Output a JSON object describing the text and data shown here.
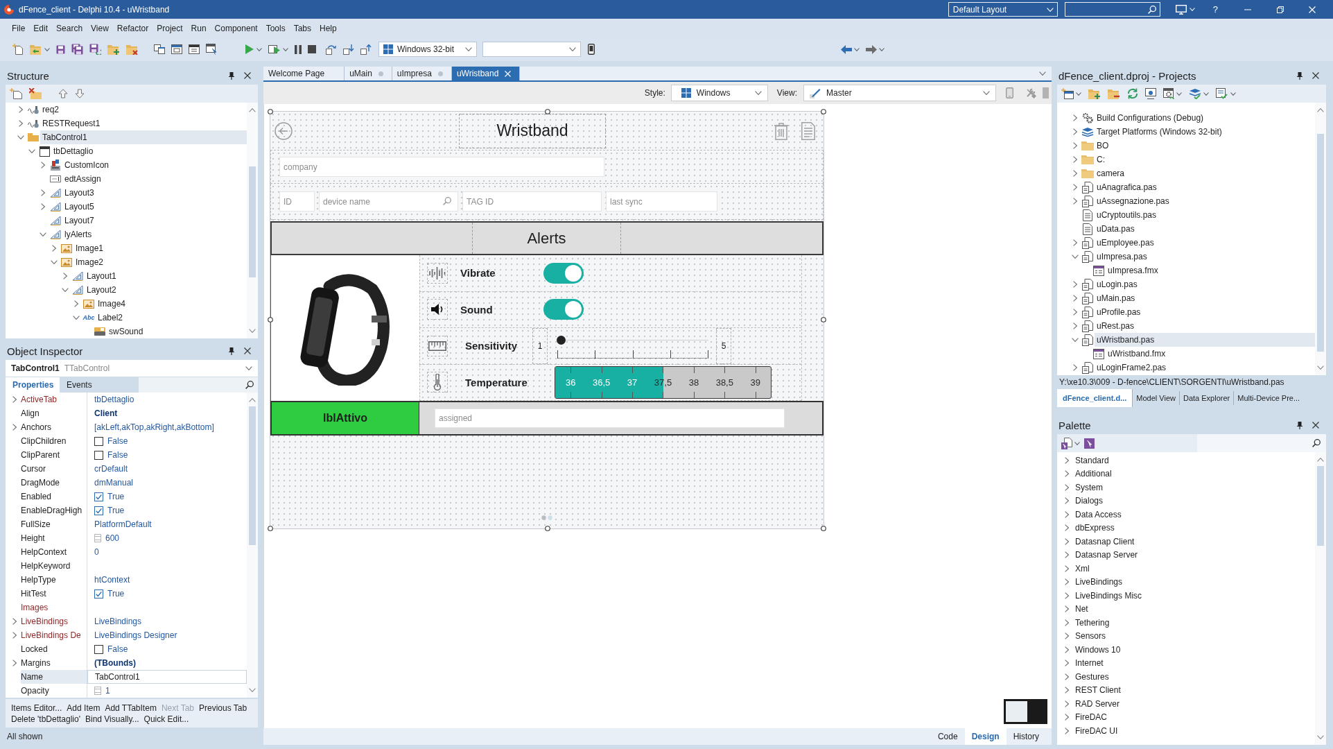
{
  "window": {
    "title": "dFence_client - Delphi 10.4 - uWristband",
    "layout": "Default Layout",
    "help": "?"
  },
  "menu": [
    "File",
    "Edit",
    "Search",
    "View",
    "Refactor",
    "Project",
    "Run",
    "Component",
    "Tools",
    "Tabs",
    "Help"
  ],
  "toolbar": {
    "platform": "Windows 32-bit"
  },
  "structure": {
    "title": "Structure",
    "tree": [
      {
        "label": "req2",
        "kind": "rest",
        "expanded": false,
        "selected": false
      },
      {
        "label": "RESTRequest1",
        "kind": "rest",
        "expanded": false,
        "selected": false
      },
      {
        "label": "TabControl1",
        "kind": "tabcontrol",
        "expanded": true,
        "selected": true,
        "children": [
          {
            "label": "tbDettaglio",
            "kind": "tabitem",
            "expanded": true,
            "selected": false,
            "children": [
              {
                "label": "CustomIcon",
                "kind": "component",
                "expanded": false,
                "selected": false
              },
              {
                "label": "edtAssign",
                "kind": "edit",
                "selected": false
              },
              {
                "label": "Layout3",
                "kind": "layout",
                "expanded": false,
                "selected": false
              },
              {
                "label": "Layout5",
                "kind": "layout",
                "expanded": false,
                "selected": false
              },
              {
                "label": "Layout7",
                "kind": "layout",
                "selected": false
              },
              {
                "label": "lyAlerts",
                "kind": "layout",
                "expanded": true,
                "selected": false,
                "children": [
                  {
                    "label": "Image1",
                    "kind": "image",
                    "expanded": false,
                    "selected": false
                  },
                  {
                    "label": "Image2",
                    "kind": "image",
                    "expanded": true,
                    "selected": false,
                    "children": [
                      {
                        "label": "Layout1",
                        "kind": "layout",
                        "expanded": false,
                        "selected": false
                      },
                      {
                        "label": "Layout2",
                        "kind": "layout",
                        "expanded": true,
                        "selected": false,
                        "children": [
                          {
                            "label": "Image4",
                            "kind": "image",
                            "expanded": false,
                            "selected": false
                          },
                          {
                            "label": "Label2",
                            "kind": "label",
                            "icon_text": "Abc",
                            "expanded": true,
                            "selected": false,
                            "children": [
                              {
                                "label": "swSound",
                                "kind": "switch",
                                "selected": false
                              }
                            ]
                          }
                        ]
                      }
                    ]
                  }
                ]
              }
            ]
          }
        ]
      }
    ]
  },
  "object_inspector": {
    "title": "Object Inspector",
    "component": "TabControl1",
    "component_type": "TTabControl",
    "tabs": [
      {
        "label": "Properties",
        "selected": true
      },
      {
        "label": "Events",
        "selected": false
      }
    ],
    "properties": [
      {
        "name": "ActiveTab",
        "value": "tbDettaglio",
        "kind": "text",
        "expandable": true,
        "reference": true,
        "modified": false,
        "selected": false
      },
      {
        "name": "Align",
        "value": "Client",
        "kind": "text",
        "expandable": false,
        "reference": false,
        "modified": true,
        "selected": false
      },
      {
        "name": "Anchors",
        "value": "[akLeft,akTop,akRight,akBottom]",
        "kind": "text",
        "expandable": true,
        "reference": false,
        "modified": false,
        "selected": false
      },
      {
        "name": "ClipChildren",
        "value": "False",
        "kind": "checkbox",
        "checked": false,
        "expandable": false,
        "reference": false,
        "modified": false,
        "selected": false
      },
      {
        "name": "ClipParent",
        "value": "False",
        "kind": "checkbox",
        "checked": false,
        "expandable": false,
        "reference": false,
        "modified": false,
        "selected": false
      },
      {
        "name": "Cursor",
        "value": "crDefault",
        "kind": "text",
        "expandable": false,
        "reference": false,
        "modified": false,
        "selected": false
      },
      {
        "name": "DragMode",
        "value": "dmManual",
        "kind": "text",
        "expandable": false,
        "reference": false,
        "modified": false,
        "selected": false
      },
      {
        "name": "Enabled",
        "value": "True",
        "kind": "checkbox",
        "checked": true,
        "expandable": false,
        "reference": false,
        "modified": false,
        "selected": false
      },
      {
        "name": "EnableDragHigh",
        "value": "True",
        "kind": "checkbox",
        "checked": true,
        "expandable": false,
        "reference": false,
        "modified": false,
        "selected": false
      },
      {
        "name": "FullSize",
        "value": "PlatformDefault",
        "kind": "text",
        "expandable": false,
        "reference": false,
        "modified": false,
        "selected": false
      },
      {
        "name": "Height",
        "value": "600",
        "kind": "spin",
        "expandable": false,
        "reference": false,
        "modified": false,
        "selected": false
      },
      {
        "name": "HelpContext",
        "value": "0",
        "kind": "text",
        "expandable": false,
        "reference": false,
        "modified": false,
        "selected": false
      },
      {
        "name": "HelpKeyword",
        "kind": "text",
        "expandable": false,
        "reference": false,
        "selected": false
      },
      {
        "name": "HelpType",
        "value": "htContext",
        "kind": "text",
        "expandable": false,
        "reference": false,
        "modified": false,
        "selected": false
      },
      {
        "name": "HitTest",
        "value": "True",
        "kind": "checkbox",
        "checked": true,
        "expandable": false,
        "reference": false,
        "modified": false,
        "selected": false
      },
      {
        "name": "Images",
        "kind": "text",
        "expandable": false,
        "reference": true,
        "selected": false
      },
      {
        "name": "LiveBindings",
        "value": "LiveBindings",
        "kind": "text",
        "expandable": true,
        "reference": true,
        "modified": false,
        "selected": false
      },
      {
        "name": "LiveBindings De",
        "value": "LiveBindings Designer",
        "kind": "text",
        "expandable": true,
        "reference": true,
        "modified": false,
        "selected": false
      },
      {
        "name": "Locked",
        "value": "False",
        "kind": "checkbox",
        "checked": false,
        "expandable": false,
        "reference": false,
        "modified": false,
        "selected": false
      },
      {
        "name": "Margins",
        "value": "(TBounds)",
        "kind": "text",
        "expandable": true,
        "reference": false,
        "modified": true,
        "selected": false
      },
      {
        "name": "Name",
        "value": "TabControl1",
        "kind": "edit",
        "expandable": false,
        "reference": false,
        "modified": false,
        "selected": true
      },
      {
        "name": "Opacity",
        "value": "1",
        "kind": "spin",
        "expandable": false,
        "reference": false,
        "modified": false,
        "selected": false
      }
    ],
    "actions": [
      {
        "label": "Items Editor...",
        "disabled": false
      },
      {
        "label": "Add Item",
        "disabled": false
      },
      {
        "label": "Add TTabItem",
        "disabled": false
      },
      {
        "label": "Next Tab",
        "disabled": true
      },
      {
        "label": "Previous Tab",
        "disabled": false
      },
      {
        "label": "Delete 'tbDettaglio'",
        "disabled": false
      },
      {
        "label": "Bind Visually...",
        "disabled": false
      },
      {
        "label": "Quick Edit...",
        "disabled": false
      }
    ],
    "status": "All shown"
  },
  "editor": {
    "tabs": [
      {
        "label": "Welcome Page",
        "selected": false,
        "dot": false
      },
      {
        "label": "uMain",
        "selected": false,
        "dot": true
      },
      {
        "label": "uImpresa",
        "selected": false,
        "dot": true
      },
      {
        "label": "uWristband",
        "selected": true,
        "dot": false
      }
    ],
    "style_label": "Style:",
    "style": "Windows",
    "view_label": "View:",
    "view": "Master",
    "form": {
      "title": "Wristband",
      "company_placeholder": "company",
      "fields": [
        {
          "placeholder": "ID",
          "kind": "plain"
        },
        {
          "placeholder": "device name",
          "kind": "search"
        },
        {
          "placeholder": "TAG ID",
          "kind": "plain"
        },
        {
          "placeholder": "last sync",
          "kind": "plain"
        }
      ],
      "alerts_title": "Alerts",
      "alerts": [
        {
          "kind": "switch",
          "label": "Vibrate",
          "on": true
        },
        {
          "kind": "switch",
          "label": "Sound",
          "on": true
        },
        {
          "kind": "slider",
          "label": "Sensitivity",
          "min": "1",
          "max": "5",
          "level": 0
        },
        {
          "kind": "range",
          "label": "Temperature",
          "level": 0.5,
          "scale": [
            "36",
            "36,5",
            "37",
            "37,5",
            "38",
            "38,5",
            "39"
          ]
        }
      ],
      "status_label": "lblAttivo",
      "assigned_placeholder": "assigned"
    },
    "bottom_tabs": [
      {
        "label": "Code",
        "selected": false
      },
      {
        "label": "Design",
        "selected": true
      },
      {
        "label": "History",
        "selected": false
      }
    ]
  },
  "projects": {
    "title": "dFence_client.dproj - Projects",
    "tree": [
      {
        "label": "Build Configurations (Debug)",
        "kind": "config",
        "expanded": false,
        "selected": false
      },
      {
        "label": "Target Platforms (Windows 32-bit)",
        "kind": "platforms",
        "expanded": false,
        "selected": false
      },
      {
        "label": "BO",
        "kind": "folder",
        "expanded": false,
        "selected": false
      },
      {
        "label": "C:",
        "kind": "folder",
        "expanded": false,
        "selected": false
      },
      {
        "label": "camera",
        "kind": "folder",
        "expanded": false,
        "selected": false
      },
      {
        "label": "uAnagrafica.pas",
        "kind": "unit",
        "expanded": false,
        "selected": false
      },
      {
        "label": "uAssegnazione.pas",
        "kind": "unit",
        "expanded": false,
        "selected": false
      },
      {
        "label": "uCryptoutils.pas",
        "kind": "file",
        "selected": false
      },
      {
        "label": "uData.pas",
        "kind": "file",
        "selected": false
      },
      {
        "label": "uEmployee.pas",
        "kind": "unit",
        "expanded": false,
        "selected": false
      },
      {
        "label": "uImpresa.pas",
        "kind": "unit",
        "expanded": true,
        "selected": false,
        "children": [
          {
            "label": "uImpresa.fmx",
            "kind": "form",
            "selected": false
          }
        ]
      },
      {
        "label": "uLogin.pas",
        "kind": "unit",
        "expanded": false,
        "selected": false
      },
      {
        "label": "uMain.pas",
        "kind": "unit",
        "expanded": false,
        "selected": false
      },
      {
        "label": "uProfile.pas",
        "kind": "unit",
        "expanded": false,
        "selected": false
      },
      {
        "label": "uRest.pas",
        "kind": "unit",
        "expanded": false,
        "selected": false
      },
      {
        "label": "uWristband.pas",
        "kind": "unit",
        "expanded": true,
        "selected": true,
        "children": [
          {
            "label": "uWristband.fmx",
            "kind": "form",
            "selected": false
          }
        ]
      },
      {
        "label": "uLoginFrame2.pas",
        "kind": "unit",
        "expanded": false,
        "selected": false
      }
    ],
    "path": "Y:\\xe10.3\\009 - D-fence\\CLIENT\\SORGENTI\\uWristband.pas",
    "tabs": [
      {
        "label": "dFence_client.d...",
        "selected": true
      },
      {
        "label": "Model View",
        "selected": false
      },
      {
        "label": "Data Explorer",
        "selected": false
      },
      {
        "label": "Multi-Device Pre...",
        "selected": false
      }
    ]
  },
  "palette": {
    "title": "Palette",
    "categories": [
      {
        "label": "Standard",
        "expanded": false
      },
      {
        "label": "Additional",
        "expanded": false
      },
      {
        "label": "System",
        "expanded": false
      },
      {
        "label": "Dialogs",
        "expanded": false
      },
      {
        "label": "Data Access",
        "expanded": false
      },
      {
        "label": "dbExpress",
        "expanded": false
      },
      {
        "label": "Datasnap Client",
        "expanded": false
      },
      {
        "label": "Datasnap Server",
        "expanded": false
      },
      {
        "label": "Xml",
        "expanded": false
      },
      {
        "label": "LiveBindings",
        "expanded": false
      },
      {
        "label": "LiveBindings Misc",
        "expanded": false
      },
      {
        "label": "Net",
        "expanded": false
      },
      {
        "label": "Tethering",
        "expanded": false
      },
      {
        "label": "Sensors",
        "expanded": false
      },
      {
        "label": "Windows 10",
        "expanded": false
      },
      {
        "label": "Internet",
        "expanded": false
      },
      {
        "label": "Gestures",
        "expanded": false
      },
      {
        "label": "REST Client",
        "expanded": false
      },
      {
        "label": "RAD Server",
        "expanded": false
      },
      {
        "label": "FireDAC",
        "expanded": false
      },
      {
        "label": "FireDAC UI",
        "expanded": false
      }
    ]
  }
}
